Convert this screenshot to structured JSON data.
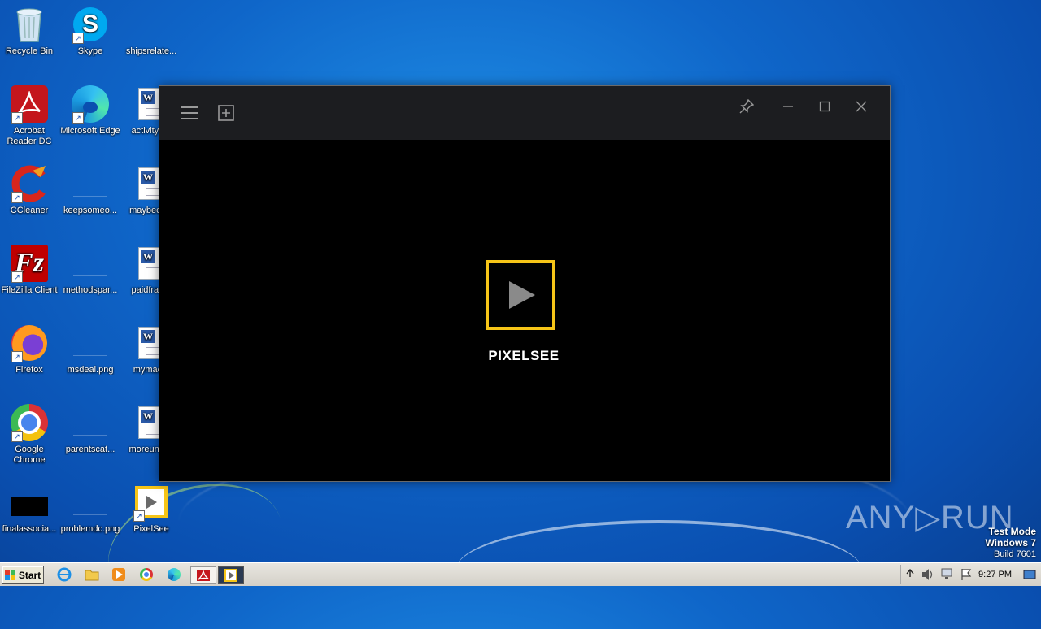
{
  "desktop": {
    "icons": [
      {
        "name": "Recycle Bin"
      },
      {
        "name": "Skype"
      },
      {
        "name": "shipsrelate..."
      },
      {
        "name": "Acrobat Reader DC"
      },
      {
        "name": "Microsoft Edge"
      },
      {
        "name": "activityu..."
      },
      {
        "name": "CCleaner"
      },
      {
        "name": "keepsomeo..."
      },
      {
        "name": "maybeca..."
      },
      {
        "name": "FileZilla Client"
      },
      {
        "name": "methodspar..."
      },
      {
        "name": "paidfran..."
      },
      {
        "name": "Firefox"
      },
      {
        "name": "msdeal.png"
      },
      {
        "name": "mymac..."
      },
      {
        "name": "Google Chrome"
      },
      {
        "name": "parentscat..."
      },
      {
        "name": "moreunle..."
      },
      {
        "name": "finalassocia..."
      },
      {
        "name": "problemdc.png"
      },
      {
        "name": "PixelSee"
      }
    ]
  },
  "app": {
    "logo_text": "PIXELSEE",
    "accent": "#f6c518"
  },
  "watermark": {
    "brand": "ANY▷RUN",
    "mode": "Test Mode",
    "os": "Windows 7",
    "build": "Build 7601"
  },
  "taskbar": {
    "start_label": "Start",
    "clock": "9:27 PM"
  }
}
